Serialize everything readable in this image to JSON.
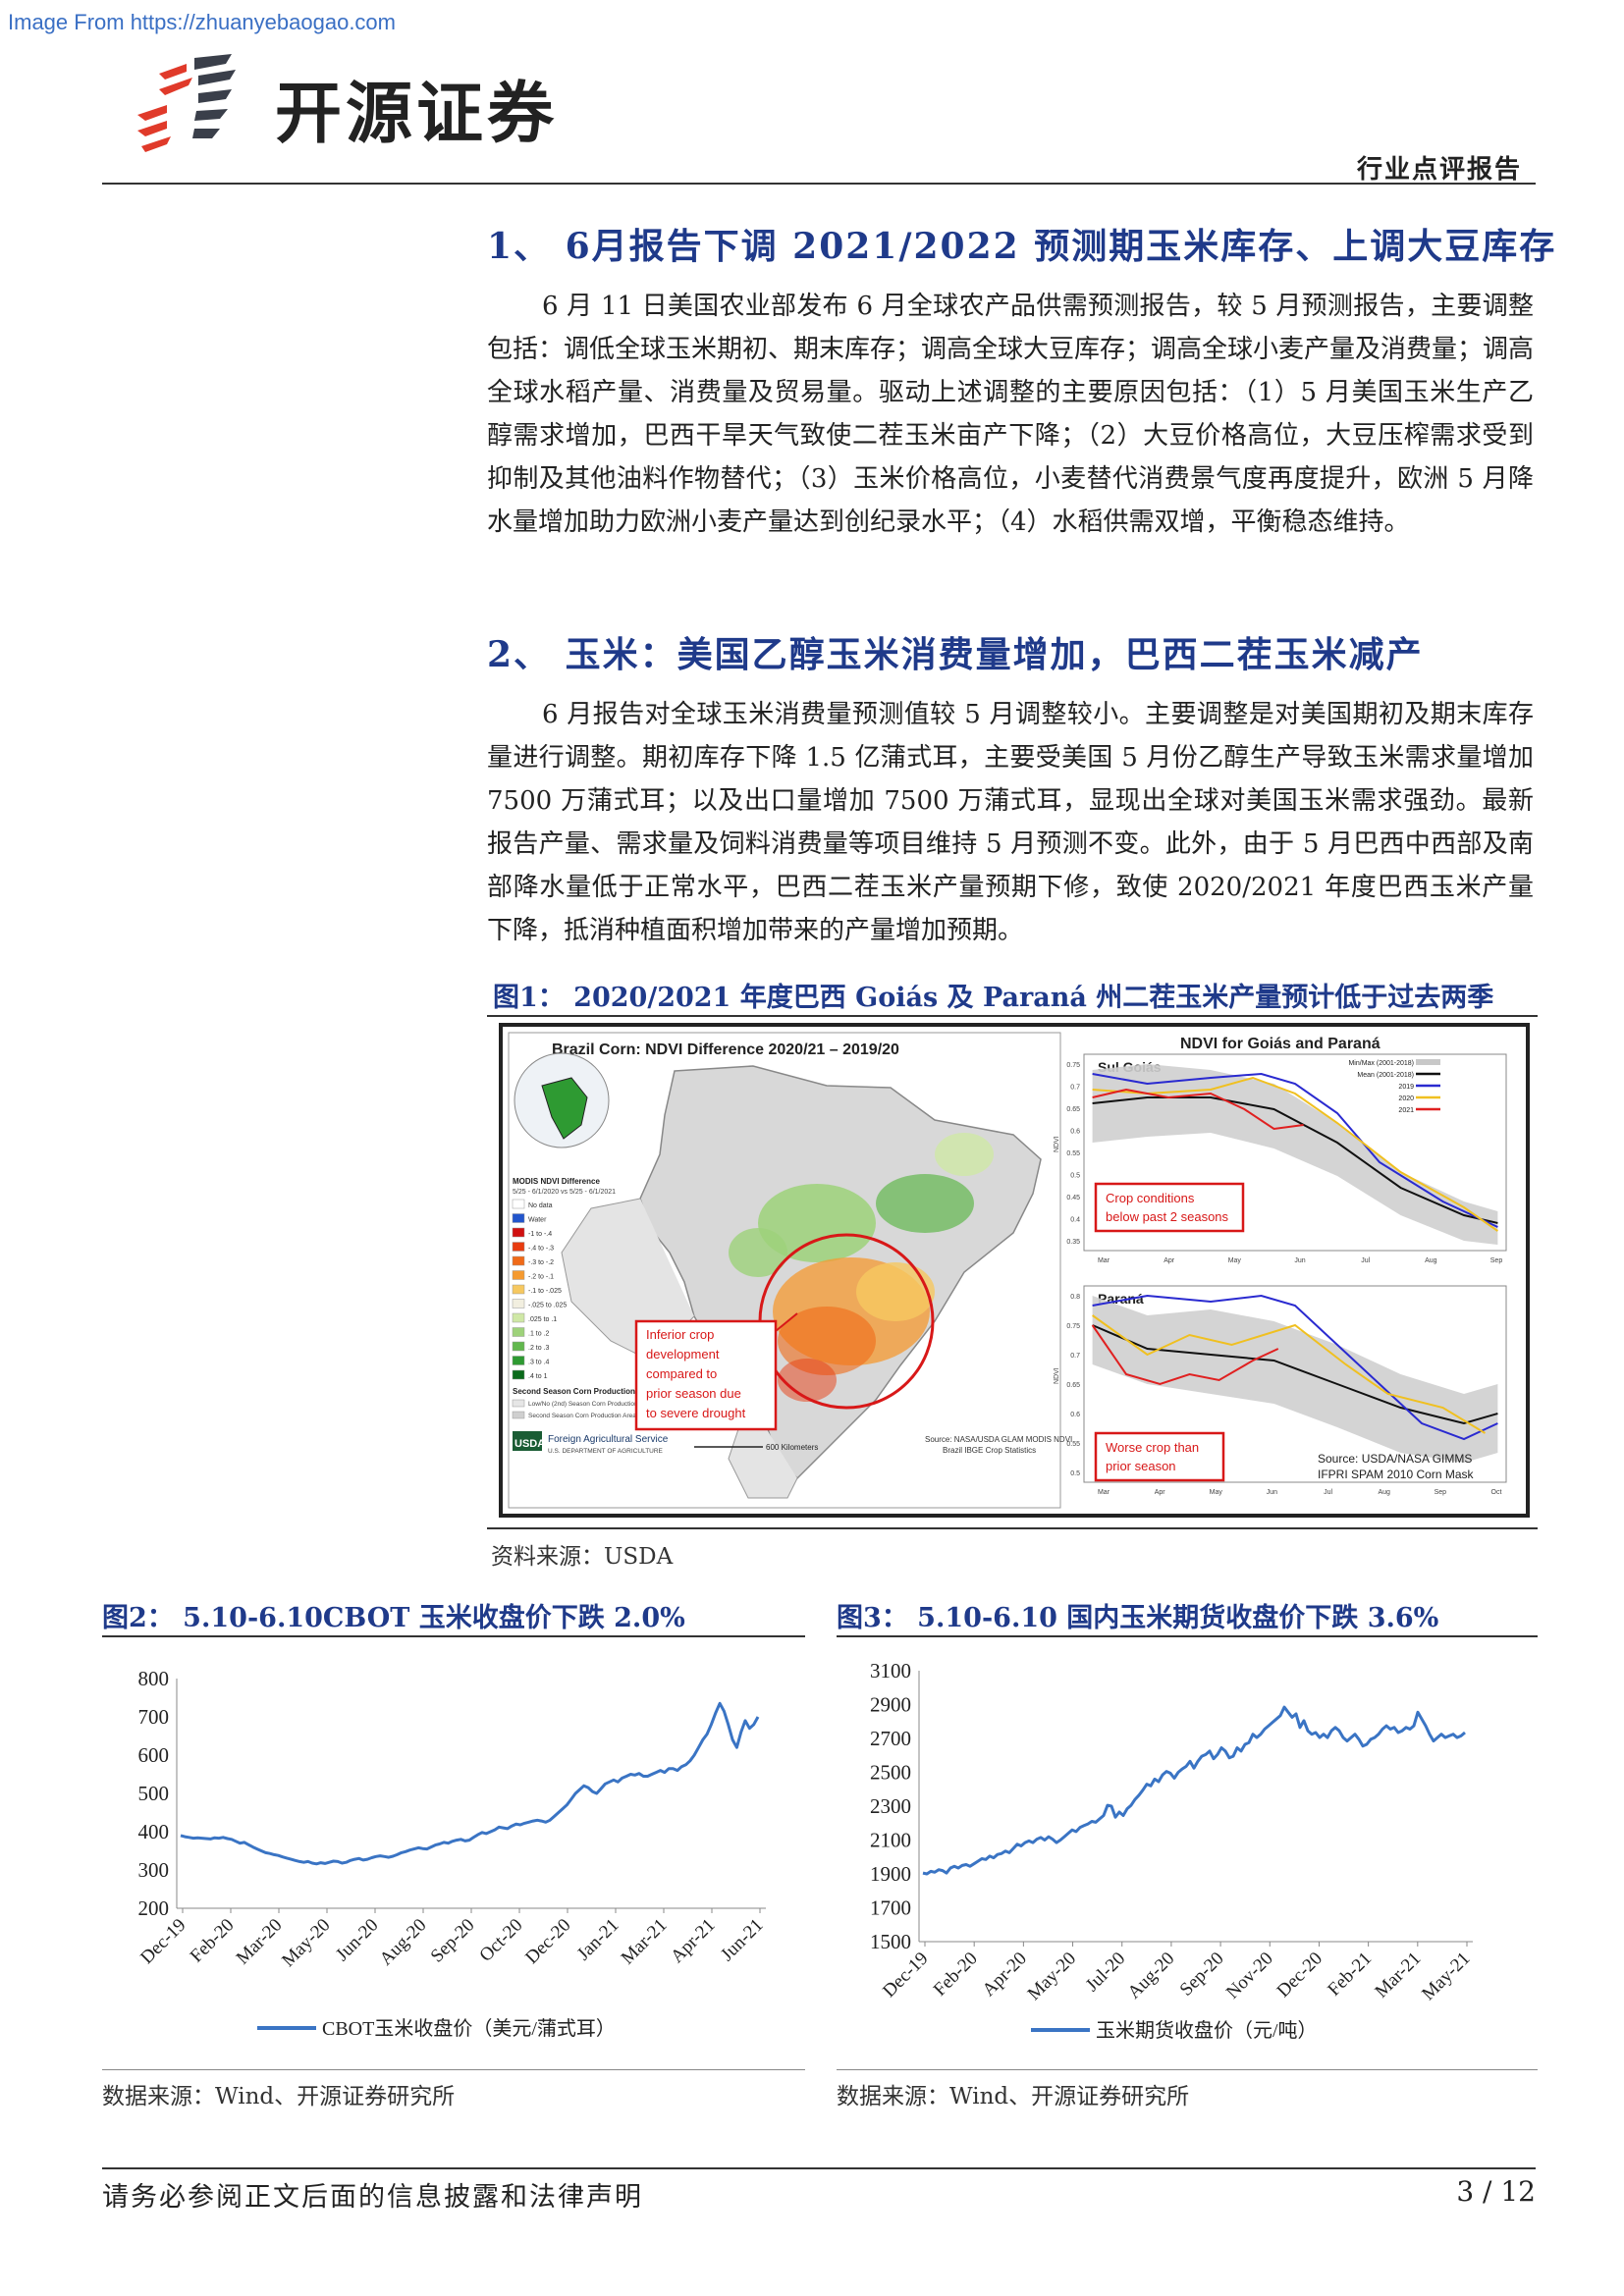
{
  "source_banner": "Image From https://zhuanyebaogao.com",
  "header": {
    "brand": "开源证券",
    "report_type": "行业点评报告"
  },
  "section1": {
    "title": "1、 6月报告下调 2021/2022 预测期玉米库存、上调大豆库存",
    "paragraph": "6 月 11 日美国农业部发布 6 月全球农产品供需预测报告，较 5 月预测报告，主要调整包括：调低全球玉米期初、期末库存；调高全球大豆库存；调高全球小麦产量及消费量；调高全球水稻产量、消费量及贸易量。驱动上述调整的主要原因包括：（1）5 月美国玉米生产乙醇需求增加，巴西干旱天气致使二茬玉米亩产下降；（2）大豆价格高位，大豆压榨需求受到抑制及其他油料作物替代；（3）玉米价格高位，小麦替代消费景气度再度提升，欧洲 5 月降水量增加助力欧洲小麦产量达到创纪录水平；（4）水稻供需双增，平衡稳态维持。"
  },
  "section2": {
    "title": "2、 玉米：美国乙醇玉米消费量增加，巴西二茬玉米减产",
    "paragraph": "6 月报告对全球玉米消费量预测值较 5 月调整较小。主要调整是对美国期初及期末库存量进行调整。期初库存下降 1.5 亿蒲式耳，主要受美国 5 月份乙醇生产导致玉米需求量增加 7500 万蒲式耳；以及出口量增加 7500 万蒲式耳，显现出全球对美国玉米需求强劲。最新报告产量、需求量及饲料消费量等项目维持 5 月预测不变。此外，由于 5 月巴西中西部及南部降水量低于正常水平，巴西二茬玉米产量预期下修，致使 2020/2021 年度巴西玉米产量下降，抵消种植面积增加带来的产量增加预期。"
  },
  "figure1": {
    "title": "图1： 2020/2021 年度巴西 Goiás 及 Paraná 州二茬玉米产量预计低于过去两季",
    "source": "资料来源：USDA",
    "map_title": "Brazil Corn: NDVI Difference 2020/21 – 2019/20",
    "ndvi_title": "NDVI for Goiás and Paraná",
    "panel1": "Sul Goiás",
    "panel2": "Paraná",
    "callout_map": [
      "Inferior crop",
      "development",
      "compared to",
      "prior season due",
      "to severe drought"
    ],
    "callout_p1": [
      "Crop conditions",
      "below past 2 seasons"
    ],
    "callout_p2": [
      "Worse crop than",
      "prior season"
    ],
    "legend": [
      "Min/Max (2001-2018)",
      "Mean (2001-2018)",
      "2019",
      "2020",
      "2021"
    ],
    "legend_colors": [
      "#c8c8c8",
      "#111111",
      "#2a2ad0",
      "#f0c020",
      "#e02020"
    ],
    "months_p1": [
      "Mar",
      "Apr",
      "May",
      "Jun",
      "Jul",
      "Aug",
      "Sep"
    ],
    "months_p2": [
      "Mar",
      "Apr",
      "May",
      "Jun",
      "Jul",
      "Aug",
      "Sep",
      "Oct"
    ],
    "yticks_p1": [
      "0.75",
      "0.7",
      "0.65",
      "0.6",
      "0.55",
      "0.5",
      "0.45",
      "0.4",
      "0.35"
    ],
    "yticks_p2": [
      "0.8",
      "0.75",
      "0.7",
      "0.65",
      "0.6",
      "0.55",
      "0.5"
    ],
    "ndvi_axis": "NDVI",
    "source_note": [
      "Source: USDA/NASA GIMMS",
      "IFPRI SPAM 2010 Corn Mask"
    ],
    "map_source": [
      "Source: NASA/USDA GLAM MODIS NDVI",
      "Brazil IBGE Crop Statistics"
    ],
    "usda_name": [
      "Foreign Agricultural Service",
      "U.S. DEPARTMENT OF AGRICULTURE"
    ],
    "map_legend_title": [
      "MODIS NDVI Difference",
      "5/25 - 6/1/2020 vs 5/25 - 6/1/2021"
    ],
    "map_legend_items": [
      "No data",
      "Water",
      "-1 to -.4",
      "-.4 to -.3",
      "-.3 to -.2",
      "-.2 to -.1",
      "-.1 to -.025",
      "-.025 to .025",
      ".025 to .1",
      ".1 to .2",
      ".2 to .3",
      ".3 to .4",
      ".4 to 1"
    ],
    "map_legend_colors": [
      "#ffffff",
      "#2255cc",
      "#d01010",
      "#e83c10",
      "#f06a18",
      "#f59a30",
      "#f6c860",
      "#f2efe0",
      "#cfe8a6",
      "#9ed27a",
      "#62b84e",
      "#2e9a32",
      "#0a6a1a"
    ],
    "map_legend_foot": [
      "Second Season Corn Production",
      "Low/No (2nd) Season Corn Production",
      "Second Season Corn Production Area"
    ],
    "scale": "600 Kilometers"
  },
  "figure2": {
    "title": "图2： 5.10-6.10CBOT 玉米收盘价下跌 2.0%",
    "source": "数据来源：Wind、开源证券研究所",
    "chart_data": {
      "type": "line",
      "yticks": [
        "800",
        "700",
        "600",
        "500",
        "400",
        "300",
        "200"
      ],
      "ylim": [
        200,
        800
      ],
      "x_tick_labels": [
        "Dec-19",
        "Feb-20",
        "Mar-20",
        "May-20",
        "Jun-20",
        "Aug-20",
        "Sep-20",
        "Oct-20",
        "Dec-20",
        "Jan-21",
        "Mar-21",
        "Apr-21",
        "Jun-21"
      ],
      "series": [
        {
          "name": "CBOT玉米收盘价（美元/蒲式耳）",
          "color": "#3a74c4",
          "values": [
            390,
            387,
            385,
            383,
            384,
            383,
            382,
            381,
            384,
            383,
            385,
            382,
            380,
            375,
            370,
            372,
            366,
            360,
            355,
            350,
            345,
            343,
            340,
            338,
            334,
            331,
            328,
            325,
            322,
            320,
            322,
            318,
            316,
            319,
            317,
            320,
            323,
            322,
            318,
            320,
            325,
            328,
            330,
            326,
            328,
            332,
            335,
            337,
            335,
            333,
            336,
            340,
            345,
            348,
            352,
            355,
            358,
            356,
            355,
            360,
            365,
            368,
            372,
            370,
            375,
            378,
            380,
            376,
            378,
            385,
            392,
            398,
            395,
            400,
            405,
            412,
            410,
            408,
            415,
            420,
            418,
            422,
            425,
            428,
            430,
            428,
            425,
            430,
            440,
            450,
            460,
            470,
            485,
            500,
            510,
            520,
            515,
            505,
            500,
            512,
            525,
            530,
            535,
            530,
            540,
            545,
            550,
            548,
            552,
            545,
            545,
            550,
            555,
            560,
            555,
            565,
            565,
            560,
            570,
            575,
            585,
            600,
            620,
            640,
            655,
            680,
            710,
            735,
            715,
            680,
            640,
            620,
            660,
            690,
            670,
            680,
            700
          ]
        }
      ]
    }
  },
  "figure3": {
    "title": "图3： 5.10-6.10 国内玉米期货收盘价下跌 3.6%",
    "source": "数据来源：Wind、开源证券研究所",
    "chart_data": {
      "type": "line",
      "yticks": [
        "3100",
        "2900",
        "2700",
        "2500",
        "2300",
        "2100",
        "1900",
        "1700",
        "1500"
      ],
      "ylim": [
        1500,
        3100
      ],
      "x_tick_labels": [
        "Dec-19",
        "Feb-20",
        "Apr-20",
        "May-20",
        "Jul-20",
        "Aug-20",
        "Sep-20",
        "Nov-20",
        "Dec-20",
        "Feb-21",
        "Mar-21",
        "May-21"
      ],
      "series": [
        {
          "name": "玉米期货收盘价（元/吨）",
          "color": "#3a74c4",
          "values": [
            1905,
            1900,
            1915,
            1910,
            1925,
            1920,
            1905,
            1935,
            1945,
            1935,
            1950,
            1955,
            1945,
            1960,
            1975,
            1990,
            1985,
            2005,
            1995,
            2015,
            2020,
            2035,
            2025,
            2050,
            2075,
            2065,
            2085,
            2095,
            2085,
            2105,
            2115,
            2100,
            2120,
            2105,
            2085,
            2100,
            2120,
            2140,
            2160,
            2150,
            2175,
            2185,
            2195,
            2210,
            2205,
            2225,
            2245,
            2305,
            2300,
            2235,
            2265,
            2245,
            2285,
            2305,
            2340,
            2365,
            2395,
            2430,
            2420,
            2460,
            2445,
            2485,
            2505,
            2495,
            2465,
            2500,
            2520,
            2535,
            2565,
            2525,
            2565,
            2595,
            2605,
            2625,
            2580,
            2605,
            2645,
            2625,
            2585,
            2595,
            2645,
            2625,
            2665,
            2675,
            2725,
            2705,
            2725,
            2755,
            2775,
            2795,
            2815,
            2835,
            2885,
            2855,
            2825,
            2845,
            2765,
            2805,
            2745,
            2725,
            2735,
            2705,
            2725,
            2705,
            2745,
            2765,
            2745,
            2705,
            2685,
            2705,
            2725,
            2695,
            2655,
            2665,
            2695,
            2705,
            2725,
            2755,
            2775,
            2755,
            2765,
            2735,
            2745,
            2765,
            2755,
            2775,
            2855,
            2815,
            2775,
            2725,
            2685,
            2705,
            2725,
            2705,
            2715,
            2725,
            2705,
            2715,
            2735
          ]
        }
      ]
    }
  },
  "footer": {
    "disclaimer": "请务必参阅正文后面的信息披露和法律声明",
    "page": "3 / 12"
  }
}
